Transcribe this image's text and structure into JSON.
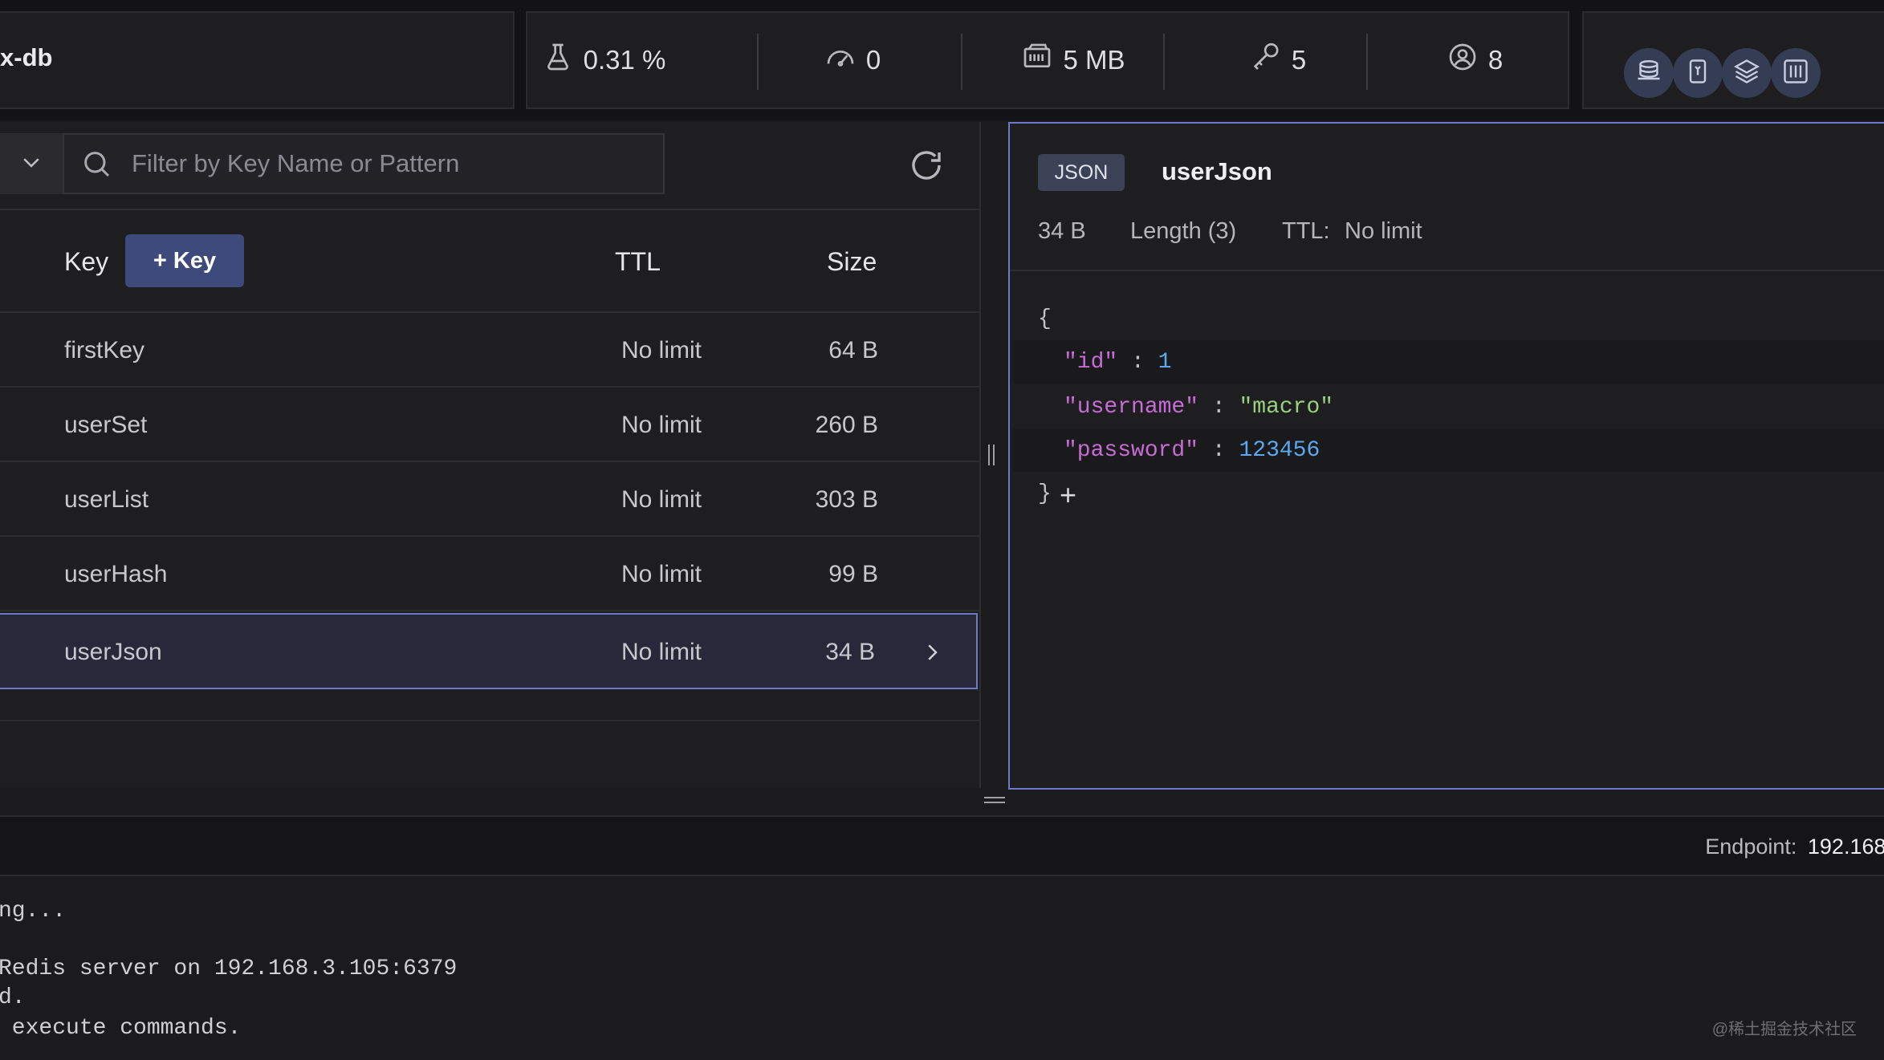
{
  "header": {
    "db_name": "x-db",
    "stats": [
      {
        "icon": "cpu-flask-icon",
        "value": "0.31 %"
      },
      {
        "icon": "gauge-icon",
        "value": "0"
      },
      {
        "icon": "memory-icon",
        "value": "5 MB"
      },
      {
        "icon": "key-icon",
        "value": "5"
      },
      {
        "icon": "user-icon",
        "value": "8"
      }
    ],
    "tools": [
      "database-stack-icon",
      "document-icon",
      "layers-icon",
      "grid-icon"
    ]
  },
  "filter": {
    "placeholder": "Filter by Key Name or Pattern"
  },
  "key_list": {
    "columns": {
      "key": "Key",
      "ttl": "TTL",
      "size": "Size"
    },
    "add_key_label": "+ Key",
    "rows": [
      {
        "name": "firstKey",
        "ttl": "No limit",
        "size": "64 B"
      },
      {
        "name": "userSet",
        "ttl": "No limit",
        "size": "260 B"
      },
      {
        "name": "userList",
        "ttl": "No limit",
        "size": "303 B"
      },
      {
        "name": "userHash",
        "ttl": "No limit",
        "size": "99 B"
      },
      {
        "name": "userJson",
        "ttl": "No limit",
        "size": "34 B"
      }
    ],
    "selected_index": 4
  },
  "details": {
    "type": "JSON",
    "key_name": "userJson",
    "size": "34 B",
    "length": "Length (3)",
    "ttl_label": "TTL:",
    "ttl_value": "No limit",
    "json": {
      "open": "{",
      "close": "}",
      "entries": [
        {
          "key": "\"id\"",
          "value": "1",
          "value_type": "number"
        },
        {
          "key": "\"username\"",
          "value": "\"macro\"",
          "value_type": "string"
        },
        {
          "key": "\"password\"",
          "value": "123456",
          "value_type": "number"
        }
      ],
      "colon": ":",
      "add_symbol": "+"
    }
  },
  "status": {
    "endpoint_label": "Endpoint:",
    "endpoint_value": "192.168."
  },
  "cli": {
    "lines": [
      "ng...",
      "",
      "Redis server on 192.168.3.105:6379",
      "d.",
      " execute commands."
    ]
  },
  "watermark": "@稀土掘金技术社区",
  "colors": {
    "accent": "#6a79c8",
    "button": "#3e4a7c",
    "json_key": "#c76bd6",
    "json_string": "#9ad17e",
    "json_number": "#5aa8f0"
  }
}
